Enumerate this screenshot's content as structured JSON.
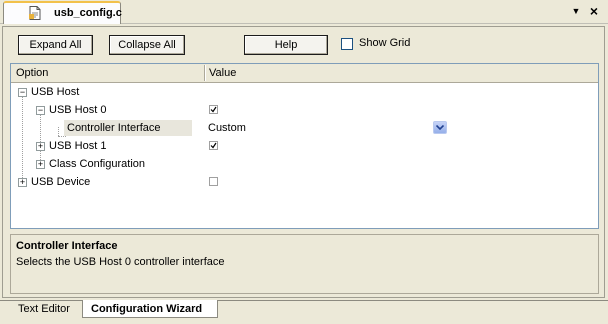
{
  "tab": {
    "label": "usb_config.c"
  },
  "window_buttons": {
    "dropdown": "▼",
    "close": "×"
  },
  "toolbar": {
    "expand_all": "Expand All",
    "collapse_all": "Collapse All",
    "help": "Help",
    "show_grid": "Show Grid",
    "show_grid_checked": false
  },
  "grid": {
    "headers": [
      "Option",
      "Value"
    ],
    "rows": [
      {
        "label": "USB Host",
        "expander": "−"
      },
      {
        "label": "USB Host 0",
        "expander": "−",
        "checked": true
      },
      {
        "label": "Controller Interface",
        "value": "Custom",
        "selected": true
      },
      {
        "label": "USB Host 1",
        "expander": "+",
        "checked": true
      },
      {
        "label": "Class Configuration",
        "expander": "+"
      },
      {
        "label": "USB Device",
        "expander": "+",
        "checked": false
      }
    ]
  },
  "description": {
    "title": "Controller Interface",
    "text": "Selects the USB Host 0 controller interface"
  },
  "bottom_tabs": [
    "Text Editor",
    "Configuration Wizard"
  ],
  "icons": {
    "file": "file-icon",
    "combo": "chevron-down-icon"
  },
  "colors": {
    "tab_accent": "#f2c14b",
    "combo_blue": "#95afe9",
    "panel_bg": "#ece9d8"
  }
}
